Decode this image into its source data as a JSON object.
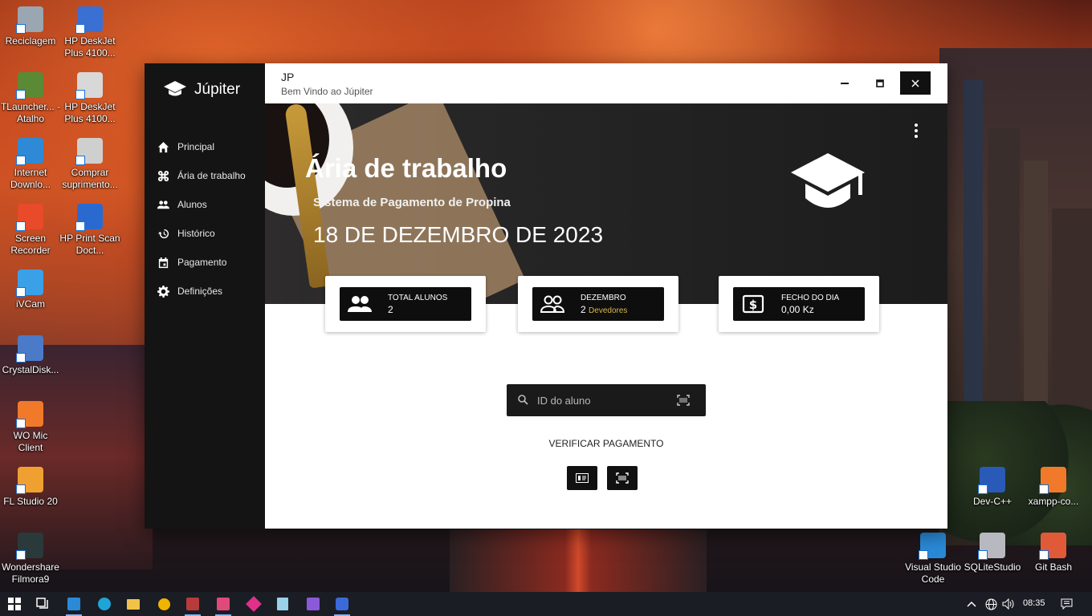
{
  "desktop": {
    "left_icons": [
      {
        "label": "Reciclagem",
        "icon": "recycle-bin-icon",
        "color": "#9aa6b2"
      },
      {
        "label": "HP DeskJet Plus 4100...",
        "icon": "printer-icon",
        "color": "#3a6fd4"
      },
      {
        "label": "TLauncher... - Atalho",
        "icon": "minecraft-icon",
        "color": "#5a8a34"
      },
      {
        "label": "HP DeskJet Plus 4100...",
        "icon": "printer-icon",
        "color": "#d8d8d8"
      },
      {
        "label": "Internet Downlo...",
        "icon": "idm-icon",
        "color": "#2e8ad6"
      },
      {
        "label": "Comprar suprimento...",
        "icon": "printer-cart-icon",
        "color": "#cfcfcf"
      },
      {
        "label": "Screen Recorder",
        "icon": "screen-recorder-icon",
        "color": "#e84a2a"
      },
      {
        "label": "HP Print Scan Doct...",
        "icon": "print-scan-icon",
        "color": "#2a6ad0"
      },
      {
        "label": "iVCam",
        "icon": "ivcam-icon",
        "color": "#3aa0e8"
      },
      {
        "label": "CrystalDisk...",
        "icon": "crystaldisk-icon",
        "color": "#4a7ac8"
      },
      {
        "label": "WO Mic Client",
        "icon": "microphone-icon",
        "color": "#f07a2a"
      },
      {
        "label": "FL Studio 20",
        "icon": "fl-studio-icon",
        "color": "#f0a030"
      },
      {
        "label": "Wondershare Filmora9",
        "icon": "filmora-icon",
        "color": "#2a3a3a"
      }
    ],
    "right_icons": [
      {
        "label": "Dev-C++",
        "icon": "devcpp-icon",
        "color": "#2a5ab8"
      },
      {
        "label": "xampp-co...",
        "icon": "xampp-icon",
        "color": "#f07a2a"
      },
      {
        "label": "Visual Studio Code",
        "icon": "vscode-icon",
        "color": "#2a8ad8"
      },
      {
        "label": "SQLiteStudio",
        "icon": "database-icon",
        "color": "#b8b8c0"
      },
      {
        "label": "Git Bash",
        "icon": "git-bash-icon",
        "color": "#e05a3a"
      }
    ]
  },
  "app": {
    "brand": "Júpiter",
    "nav": [
      {
        "label": "Principal",
        "icon": "home-icon"
      },
      {
        "label": "Ária de trabalho",
        "icon": "command-icon"
      },
      {
        "label": "Alunos",
        "icon": "people-icon"
      },
      {
        "label": "Histórico",
        "icon": "history-icon"
      },
      {
        "label": "Pagamento",
        "icon": "calendar-icon"
      },
      {
        "label": "Definições",
        "icon": "gear-icon"
      }
    ],
    "titlebar": {
      "title": "JP",
      "subtitle": "Bem Vindo ao  Júpiter"
    },
    "hero": {
      "title": "Ária de trabalho",
      "subtitle": "Sistema de Pagamento de Propina",
      "date": "18 DE DEZEMBRO DE 2023"
    },
    "cards": [
      {
        "label": "TOTAL ALUNOS",
        "value": "2",
        "sub": "",
        "icon": "people-icon"
      },
      {
        "label": "DEZEMBRO",
        "value": "2",
        "sub": "Devedores",
        "icon": "people-outline-icon"
      },
      {
        "label": "FECHO DO DIA",
        "value": "0,00 Kz",
        "sub": "",
        "icon": "money-icon"
      }
    ],
    "search": {
      "placeholder": "ID do aluno"
    },
    "verify_label": "VERIFICAR PAGAMENTO"
  },
  "taskbar": {
    "time": "08:35",
    "accent": "#8ab4f8"
  }
}
